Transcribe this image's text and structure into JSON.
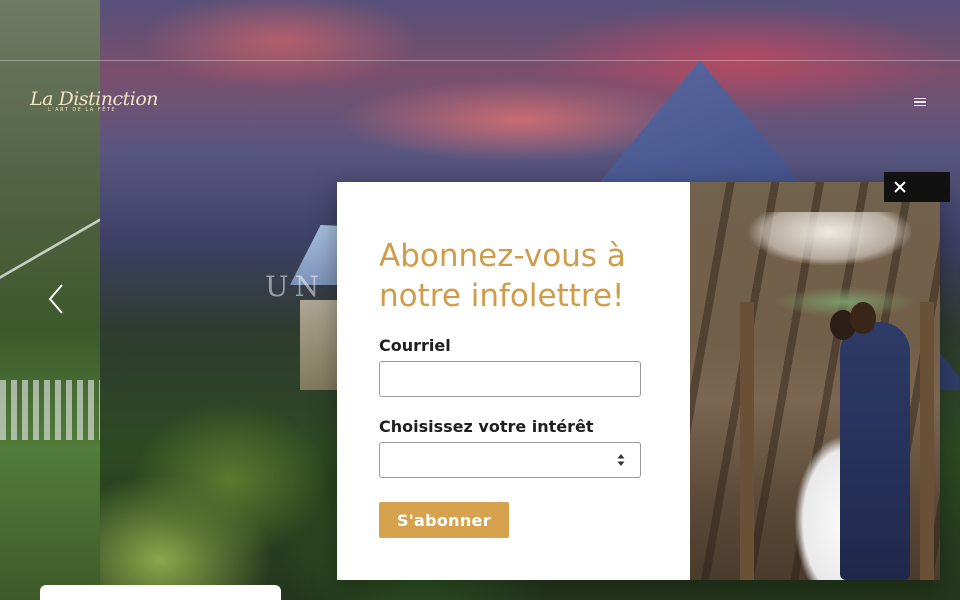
{
  "hero": {
    "overlay_text": "UN",
    "logo": {
      "script_text": "La Distinction",
      "tagline": "L'ART DE LA FÊTE"
    }
  },
  "nav": {
    "menu_icon": "hamburger-menu-icon",
    "prev_icon": "chevron-left-icon"
  },
  "popup": {
    "title": "Abonnez-vous à notre infolettre!",
    "email_label": "Courriel",
    "email_value": "",
    "interest_label": "Choisissez votre intérêt",
    "interest_selected": "",
    "submit_label": "S'abonner",
    "close_icon": "close-icon",
    "photo_alt": "Couple de mariés dans une grange"
  },
  "colors": {
    "accent": "#d6a24e",
    "title": "#cf9d4a",
    "close_bg": "#111111"
  }
}
